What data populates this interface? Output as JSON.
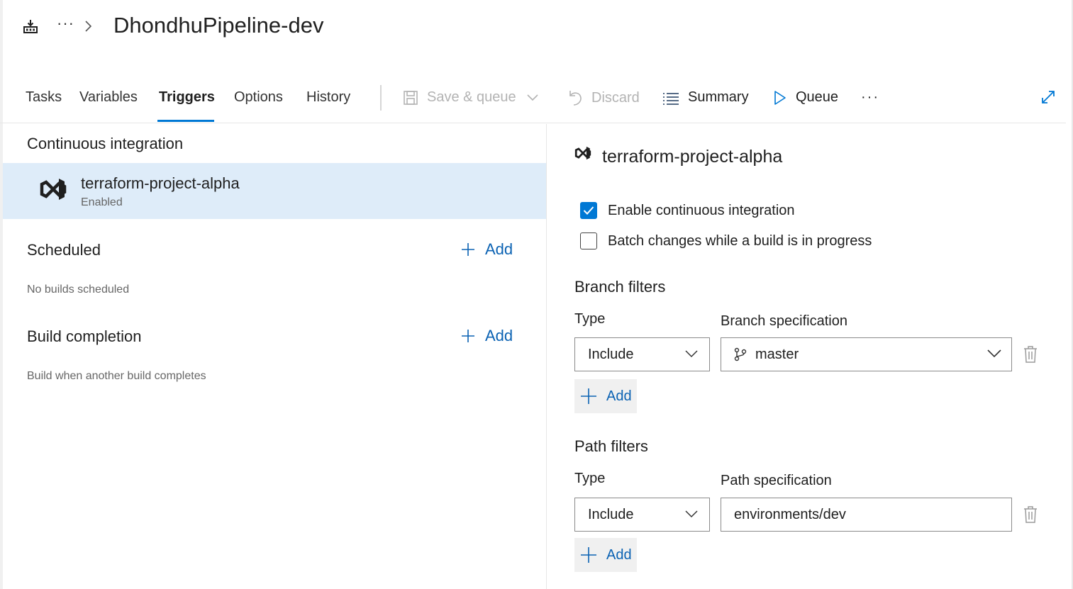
{
  "header": {
    "more": "···",
    "title": "DhondhuPipeline-dev"
  },
  "tabs": [
    {
      "label": "Tasks"
    },
    {
      "label": "Variables"
    },
    {
      "label": "Triggers"
    },
    {
      "label": "Options"
    },
    {
      "label": "History"
    }
  ],
  "active_tab": "Triggers",
  "toolbar": {
    "save_queue": "Save & queue",
    "discard": "Discard",
    "summary": "Summary",
    "queue": "Queue",
    "more": "···"
  },
  "left": {
    "ci_title": "Continuous integration",
    "ci_repo": {
      "name": "terraform-project-alpha",
      "status": "Enabled"
    },
    "scheduled_title": "Scheduled",
    "scheduled_note": "No builds scheduled",
    "build_completion_title": "Build completion",
    "build_completion_note": "Build when another build completes",
    "add_label": "Add"
  },
  "right": {
    "repo_title": "terraform-project-alpha",
    "enable_ci": {
      "label": "Enable continuous integration",
      "checked": true
    },
    "batch_changes": {
      "label": "Batch changes while a build is in progress",
      "checked": false
    },
    "branch_filters": {
      "title": "Branch filters",
      "type_label": "Type",
      "spec_label": "Branch specification",
      "type_value": "Include",
      "spec_value": "master",
      "add_label": "Add"
    },
    "path_filters": {
      "title": "Path filters",
      "type_label": "Type",
      "spec_label": "Path specification",
      "type_value": "Include",
      "spec_value": "environments/dev",
      "add_label": "Add"
    }
  },
  "colors": {
    "accent": "#0078d4",
    "link": "#0b62b3",
    "selected_row": "#deecf9",
    "disabled_text": "#b3b3b3"
  },
  "icons": {
    "pipeline": "pipeline-icon",
    "chevron_right": "chevron-right-icon",
    "save": "save-icon",
    "discard": "undo-icon",
    "summary": "list-icon",
    "queue": "play-icon",
    "expand": "expand-icon",
    "repo": "visual-studio-icon",
    "branch": "git-branch-icon",
    "trash": "trash-icon",
    "add": "plus-icon"
  }
}
